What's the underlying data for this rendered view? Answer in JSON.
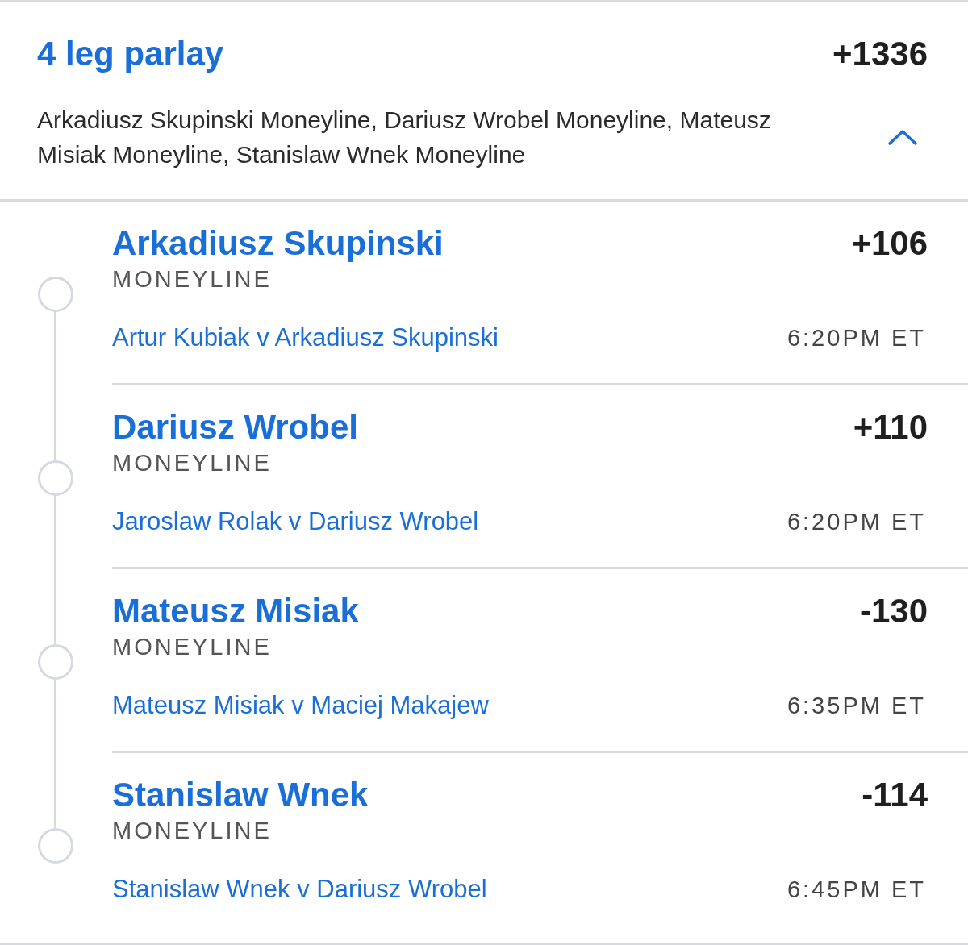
{
  "parlay": {
    "title": "4 leg parlay",
    "odds": "+1336",
    "description": "Arkadiusz Skupinski Moneyline, Dariusz Wrobel Moneyline, Mateusz Misiak Moneyline, Stanislaw Wnek Moneyline",
    "expanded": true
  },
  "legs": [
    {
      "selection": "Arkadiusz Skupinski",
      "odds": "+106",
      "market": "MONEYLINE",
      "event": "Artur Kubiak v Arkadiusz Skupinski",
      "time": "6:20PM ET"
    },
    {
      "selection": "Dariusz Wrobel",
      "odds": "+110",
      "market": "MONEYLINE",
      "event": "Jaroslaw Rolak v Dariusz Wrobel",
      "time": "6:20PM ET"
    },
    {
      "selection": "Mateusz Misiak",
      "odds": "-130",
      "market": "MONEYLINE",
      "event": "Mateusz Misiak v Maciej Makajew",
      "time": "6:35PM ET"
    },
    {
      "selection": "Stanislaw Wnek",
      "odds": "-114",
      "market": "MONEYLINE",
      "event": "Stanislaw Wnek v Dariusz Wrobel",
      "time": "6:45PM ET"
    }
  ]
}
